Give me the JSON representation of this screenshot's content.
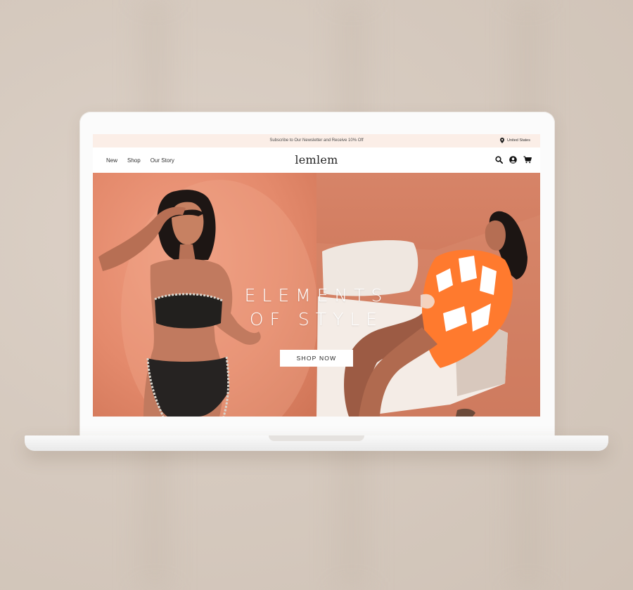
{
  "promo_bar": {
    "text": "Subscribe to Our Newsletter and Receive 10% Off",
    "region_icon": "location-pin-icon",
    "region": "United States"
  },
  "nav": {
    "links": [
      "New",
      "Shop",
      "Our Story"
    ],
    "logo": "lemlem",
    "icons": [
      "search-icon",
      "account-icon",
      "cart-icon"
    ]
  },
  "hero": {
    "title_line1": "ELEMENTS",
    "title_line2": "OF STYLE",
    "cta": "SHOP NOW"
  },
  "colors": {
    "promo_bg": "#fbeee7",
    "hero_left": "#e48a6c",
    "hero_right": "#cd7659",
    "backdrop": "#d6cabf"
  }
}
